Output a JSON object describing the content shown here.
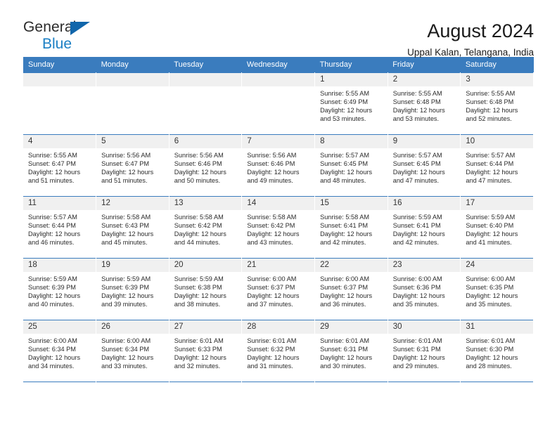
{
  "brand": {
    "name_part1": "General",
    "name_part2": "Blue",
    "accent_color": "#1b7fc4",
    "triangle_color": "#1166ab"
  },
  "header": {
    "title": "August 2024",
    "subtitle": "Uppal Kalan, Telangana, India",
    "header_bg": "#3a7cbe"
  },
  "calendar": {
    "weekday_headers": [
      "Sunday",
      "Monday",
      "Tuesday",
      "Wednesday",
      "Thursday",
      "Friday",
      "Saturday"
    ],
    "weeks": [
      [
        {
          "day": "",
          "empty": true
        },
        {
          "day": "",
          "empty": true
        },
        {
          "day": "",
          "empty": true
        },
        {
          "day": "",
          "empty": true
        },
        {
          "day": "1",
          "sunrise": "Sunrise: 5:55 AM",
          "sunset": "Sunset: 6:49 PM",
          "daylight1": "Daylight: 12 hours",
          "daylight2": "and 53 minutes."
        },
        {
          "day": "2",
          "sunrise": "Sunrise: 5:55 AM",
          "sunset": "Sunset: 6:48 PM",
          "daylight1": "Daylight: 12 hours",
          "daylight2": "and 53 minutes."
        },
        {
          "day": "3",
          "sunrise": "Sunrise: 5:55 AM",
          "sunset": "Sunset: 6:48 PM",
          "daylight1": "Daylight: 12 hours",
          "daylight2": "and 52 minutes."
        }
      ],
      [
        {
          "day": "4",
          "sunrise": "Sunrise: 5:55 AM",
          "sunset": "Sunset: 6:47 PM",
          "daylight1": "Daylight: 12 hours",
          "daylight2": "and 51 minutes."
        },
        {
          "day": "5",
          "sunrise": "Sunrise: 5:56 AM",
          "sunset": "Sunset: 6:47 PM",
          "daylight1": "Daylight: 12 hours",
          "daylight2": "and 51 minutes."
        },
        {
          "day": "6",
          "sunrise": "Sunrise: 5:56 AM",
          "sunset": "Sunset: 6:46 PM",
          "daylight1": "Daylight: 12 hours",
          "daylight2": "and 50 minutes."
        },
        {
          "day": "7",
          "sunrise": "Sunrise: 5:56 AM",
          "sunset": "Sunset: 6:46 PM",
          "daylight1": "Daylight: 12 hours",
          "daylight2": "and 49 minutes."
        },
        {
          "day": "8",
          "sunrise": "Sunrise: 5:57 AM",
          "sunset": "Sunset: 6:45 PM",
          "daylight1": "Daylight: 12 hours",
          "daylight2": "and 48 minutes."
        },
        {
          "day": "9",
          "sunrise": "Sunrise: 5:57 AM",
          "sunset": "Sunset: 6:45 PM",
          "daylight1": "Daylight: 12 hours",
          "daylight2": "and 47 minutes."
        },
        {
          "day": "10",
          "sunrise": "Sunrise: 5:57 AM",
          "sunset": "Sunset: 6:44 PM",
          "daylight1": "Daylight: 12 hours",
          "daylight2": "and 47 minutes."
        }
      ],
      [
        {
          "day": "11",
          "sunrise": "Sunrise: 5:57 AM",
          "sunset": "Sunset: 6:44 PM",
          "daylight1": "Daylight: 12 hours",
          "daylight2": "and 46 minutes."
        },
        {
          "day": "12",
          "sunrise": "Sunrise: 5:58 AM",
          "sunset": "Sunset: 6:43 PM",
          "daylight1": "Daylight: 12 hours",
          "daylight2": "and 45 minutes."
        },
        {
          "day": "13",
          "sunrise": "Sunrise: 5:58 AM",
          "sunset": "Sunset: 6:42 PM",
          "daylight1": "Daylight: 12 hours",
          "daylight2": "and 44 minutes."
        },
        {
          "day": "14",
          "sunrise": "Sunrise: 5:58 AM",
          "sunset": "Sunset: 6:42 PM",
          "daylight1": "Daylight: 12 hours",
          "daylight2": "and 43 minutes."
        },
        {
          "day": "15",
          "sunrise": "Sunrise: 5:58 AM",
          "sunset": "Sunset: 6:41 PM",
          "daylight1": "Daylight: 12 hours",
          "daylight2": "and 42 minutes."
        },
        {
          "day": "16",
          "sunrise": "Sunrise: 5:59 AM",
          "sunset": "Sunset: 6:41 PM",
          "daylight1": "Daylight: 12 hours",
          "daylight2": "and 42 minutes."
        },
        {
          "day": "17",
          "sunrise": "Sunrise: 5:59 AM",
          "sunset": "Sunset: 6:40 PM",
          "daylight1": "Daylight: 12 hours",
          "daylight2": "and 41 minutes."
        }
      ],
      [
        {
          "day": "18",
          "sunrise": "Sunrise: 5:59 AM",
          "sunset": "Sunset: 6:39 PM",
          "daylight1": "Daylight: 12 hours",
          "daylight2": "and 40 minutes."
        },
        {
          "day": "19",
          "sunrise": "Sunrise: 5:59 AM",
          "sunset": "Sunset: 6:39 PM",
          "daylight1": "Daylight: 12 hours",
          "daylight2": "and 39 minutes."
        },
        {
          "day": "20",
          "sunrise": "Sunrise: 5:59 AM",
          "sunset": "Sunset: 6:38 PM",
          "daylight1": "Daylight: 12 hours",
          "daylight2": "and 38 minutes."
        },
        {
          "day": "21",
          "sunrise": "Sunrise: 6:00 AM",
          "sunset": "Sunset: 6:37 PM",
          "daylight1": "Daylight: 12 hours",
          "daylight2": "and 37 minutes."
        },
        {
          "day": "22",
          "sunrise": "Sunrise: 6:00 AM",
          "sunset": "Sunset: 6:37 PM",
          "daylight1": "Daylight: 12 hours",
          "daylight2": "and 36 minutes."
        },
        {
          "day": "23",
          "sunrise": "Sunrise: 6:00 AM",
          "sunset": "Sunset: 6:36 PM",
          "daylight1": "Daylight: 12 hours",
          "daylight2": "and 35 minutes."
        },
        {
          "day": "24",
          "sunrise": "Sunrise: 6:00 AM",
          "sunset": "Sunset: 6:35 PM",
          "daylight1": "Daylight: 12 hours",
          "daylight2": "and 35 minutes."
        }
      ],
      [
        {
          "day": "25",
          "sunrise": "Sunrise: 6:00 AM",
          "sunset": "Sunset: 6:34 PM",
          "daylight1": "Daylight: 12 hours",
          "daylight2": "and 34 minutes."
        },
        {
          "day": "26",
          "sunrise": "Sunrise: 6:00 AM",
          "sunset": "Sunset: 6:34 PM",
          "daylight1": "Daylight: 12 hours",
          "daylight2": "and 33 minutes."
        },
        {
          "day": "27",
          "sunrise": "Sunrise: 6:01 AM",
          "sunset": "Sunset: 6:33 PM",
          "daylight1": "Daylight: 12 hours",
          "daylight2": "and 32 minutes."
        },
        {
          "day": "28",
          "sunrise": "Sunrise: 6:01 AM",
          "sunset": "Sunset: 6:32 PM",
          "daylight1": "Daylight: 12 hours",
          "daylight2": "and 31 minutes."
        },
        {
          "day": "29",
          "sunrise": "Sunrise: 6:01 AM",
          "sunset": "Sunset: 6:31 PM",
          "daylight1": "Daylight: 12 hours",
          "daylight2": "and 30 minutes."
        },
        {
          "day": "30",
          "sunrise": "Sunrise: 6:01 AM",
          "sunset": "Sunset: 6:31 PM",
          "daylight1": "Daylight: 12 hours",
          "daylight2": "and 29 minutes."
        },
        {
          "day": "31",
          "sunrise": "Sunrise: 6:01 AM",
          "sunset": "Sunset: 6:30 PM",
          "daylight1": "Daylight: 12 hours",
          "daylight2": "and 28 minutes."
        }
      ]
    ]
  }
}
